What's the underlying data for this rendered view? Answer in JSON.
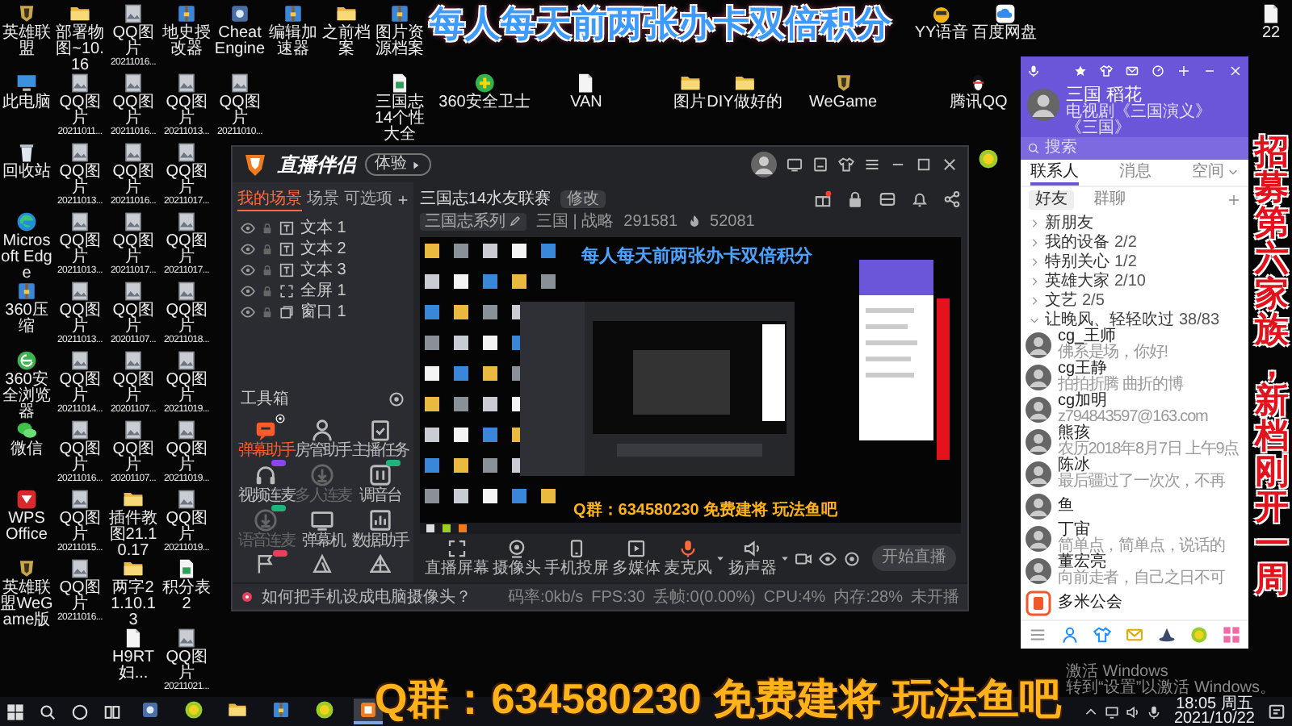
{
  "desktop_columns": [
    {
      "icons": [
        {
          "kind": "game",
          "label": "英雄联盟"
        },
        {
          "kind": "pc",
          "label": "此电脑"
        },
        {
          "kind": "bin",
          "label": "回收站"
        },
        {
          "kind": "edge",
          "label": "Microsoft Edge"
        },
        {
          "kind": "zip",
          "label": "360压缩"
        },
        {
          "kind": "browser",
          "label": "360安全浏览器"
        },
        {
          "kind": "chat",
          "label": "微信"
        },
        {
          "kind": "wps",
          "label": "WPS Office"
        },
        {
          "kind": "game",
          "label": "英雄联盟WeGame版"
        }
      ]
    },
    {
      "icons": [
        {
          "kind": "folder",
          "label": "部署物图~10.16"
        },
        {
          "kind": "photo",
          "label": "QQ图片",
          "sub": "20211011..."
        },
        {
          "kind": "photo",
          "label": "QQ图片",
          "sub": "20211013..."
        },
        {
          "kind": "photo",
          "label": "QQ图片",
          "sub": "20211013..."
        },
        {
          "kind": "photo",
          "label": "QQ图片",
          "sub": "20211013..."
        },
        {
          "kind": "photo",
          "label": "QQ图片",
          "sub": "20211014..."
        },
        {
          "kind": "photo",
          "label": "QQ图片",
          "sub": "20211016..."
        },
        {
          "kind": "photo",
          "label": "QQ图片",
          "sub": "20211015..."
        },
        {
          "kind": "photo",
          "label": "QQ图片",
          "sub": "20211016..."
        }
      ]
    },
    {
      "icons": [
        {
          "kind": "photo",
          "label": "QQ图片",
          "sub": "20211016..."
        },
        {
          "kind": "photo",
          "label": "QQ图片",
          "sub": "20211016..."
        },
        {
          "kind": "photo",
          "label": "QQ图片",
          "sub": "20211016..."
        },
        {
          "kind": "photo",
          "label": "QQ图片",
          "sub": "20211017..."
        },
        {
          "kind": "photo",
          "label": "QQ图片",
          "sub": "20201107..."
        },
        {
          "kind": "photo",
          "label": "QQ图片",
          "sub": "20201107..."
        },
        {
          "kind": "photo",
          "label": "QQ图片",
          "sub": "20201107..."
        },
        {
          "kind": "folder",
          "label": "插件教图21.10.17"
        },
        {
          "kind": "folder",
          "label": "两字21.10.13"
        },
        {
          "kind": "doc",
          "label": "H9RT 妇..."
        }
      ]
    },
    {
      "icons": [
        {
          "kind": "zip",
          "label": "地史授改器"
        },
        {
          "kind": "photo",
          "label": "QQ图片",
          "sub": "20211013..."
        },
        {
          "kind": "photo",
          "label": "QQ图片",
          "sub": "20211017..."
        },
        {
          "kind": "photo",
          "label": "QQ图片",
          "sub": "20211017..."
        },
        {
          "kind": "photo",
          "label": "QQ图片",
          "sub": "20211018..."
        },
        {
          "kind": "photo",
          "label": "QQ图片",
          "sub": "20211019..."
        },
        {
          "kind": "photo",
          "label": "QQ图片",
          "sub": "20211019..."
        },
        {
          "kind": "photo",
          "label": "QQ图片",
          "sub": "20211019..."
        },
        {
          "kind": "sheet",
          "label": "积分表2"
        },
        {
          "kind": "photo",
          "label": "QQ图片",
          "sub": "20211021..."
        }
      ]
    }
  ],
  "desktop_top": [
    {
      "icons": [
        {
          "kind": "app",
          "label": "Cheat Engine"
        },
        {
          "kind": "zip",
          "label": "编辑加速器"
        },
        {
          "kind": "folder",
          "label": "之前档案"
        },
        {
          "kind": "zip",
          "label": "图片资源档案"
        }
      ]
    },
    {
      "icons": [
        {
          "kind": "photo",
          "label": "QQ图片",
          "sub": "20211010..."
        },
        {
          "kind": "sheet",
          "label": "三国志14个性大全"
        }
      ]
    }
  ],
  "desktop_free": [
    {
      "kind": "mascot",
      "label": "YY语音"
    },
    {
      "kind": "cloud",
      "label": "百度网盘"
    },
    {
      "kind": "doc",
      "label": "22"
    },
    {
      "kind": "shield",
      "label": "360安全卫士"
    },
    {
      "kind": "doc",
      "label": "VAN"
    },
    {
      "kind": "folder",
      "label": "图片"
    },
    {
      "kind": "folder",
      "label": "DIY做好的"
    },
    {
      "kind": "game",
      "label": "WeGame"
    },
    {
      "kind": "penguin",
      "label": "腾讯QQ"
    },
    {
      "kind": "ball"
    }
  ],
  "overlays": {
    "top_caption": "每人每天前两张办卡双倍积分",
    "side_caption": "招募第六家族，新档刚开一周",
    "bottom_caption": "Q群：634580230 免费建将 玩法鱼吧"
  },
  "live_app": {
    "title": "直播伴侣",
    "version_tag": "体验",
    "scene_tabs": [
      {
        "label": "我的场景",
        "selected": true
      },
      {
        "label": "场景",
        "selected": false
      },
      {
        "label": "可选项",
        "selected": false
      }
    ],
    "sources": [
      {
        "kind": "text",
        "label": "文本 1"
      },
      {
        "kind": "text",
        "label": "文本 2"
      },
      {
        "kind": "text",
        "label": "文本 3"
      },
      {
        "kind": "screen",
        "label": "全屏 1"
      },
      {
        "kind": "window",
        "label": "窗口 1"
      }
    ],
    "toolbox_title": "工具箱",
    "tools": [
      {
        "label": "弹幕助手",
        "kind": "bubble",
        "selected": true,
        "disabled": false,
        "gear_badge": true
      },
      {
        "label": "房管助手",
        "kind": "person",
        "selected": false,
        "disabled": false
      },
      {
        "label": "主播任务",
        "kind": "clip",
        "selected": false,
        "disabled": false
      },
      {
        "label": "视频连麦",
        "kind": "headset",
        "selected": false,
        "disabled": false,
        "color": "#8e44ec"
      },
      {
        "label": "多人连麦",
        "kind": "download",
        "selected": false,
        "disabled": true
      },
      {
        "label": "调音台",
        "kind": "sliders",
        "selected": false,
        "disabled": false,
        "color": "#1fb57a"
      },
      {
        "label": "语音连麦",
        "kind": "download",
        "selected": false,
        "disabled": true,
        "color": "#1fb57a"
      },
      {
        "label": "弹幕机",
        "kind": "tv",
        "selected": false,
        "disabled": false
      },
      {
        "label": "数据助手",
        "kind": "chart",
        "selected": false,
        "disabled": false
      },
      {
        "kind": "flag",
        "selected": false,
        "disabled": false,
        "color": "#e8405a"
      },
      {
        "kind": "triangle",
        "selected": false,
        "disabled": false
      },
      {
        "kind": "tent",
        "selected": false,
        "disabled": false
      }
    ],
    "stream": {
      "title": "三国志14水友联赛",
      "edit_label": "修改",
      "category": "三国志系列",
      "tags": "三国 | 战略",
      "room": "291581",
      "heat": "52081"
    },
    "preview": {
      "top_caption": "每人每天前两张办卡双倍积分",
      "bottom_caption": "Q群：634580230 免费建将 玩法鱼吧"
    },
    "controls": [
      {
        "label": "直播屏幕",
        "kind": "screen",
        "on": false,
        "dropdown": false
      },
      {
        "label": "摄像头",
        "kind": "webcam",
        "on": false,
        "dropdown": false
      },
      {
        "label": "手机投屏",
        "kind": "phone",
        "on": false,
        "dropdown": false
      },
      {
        "label": "多媒体",
        "kind": "play",
        "on": false,
        "dropdown": false
      },
      {
        "label": "麦克风",
        "kind": "mic",
        "on": true,
        "dropdown": true
      },
      {
        "label": "扬声器",
        "kind": "speaker",
        "on": false,
        "dropdown": true
      }
    ],
    "start_label": "开始直播",
    "status": {
      "tip": "如何把手机设成电脑摄像头？",
      "metrics": [
        "码率:0kb/s",
        "FPS:30",
        "丢帧:0(0.00%)",
        "CPU:4%",
        "内存:28%",
        "未开播"
      ]
    }
  },
  "qq": {
    "name": "三国 稻花",
    "signature": "电视剧《三国演义》《三国》",
    "search_placeholder": "搜索",
    "tabs": [
      {
        "label": "联系人",
        "selected": true,
        "dropdown": false
      },
      {
        "label": "消息",
        "selected": false,
        "dropdown": false
      },
      {
        "label": "空间",
        "selected": false,
        "dropdown": true
      }
    ],
    "subtabs": [
      {
        "label": "好友",
        "selected": true
      },
      {
        "label": "群聊",
        "selected": false
      }
    ],
    "groups": [
      {
        "name": "新朋友",
        "expanded": false
      },
      {
        "name": "我的设备",
        "count": "2/2",
        "expanded": false
      },
      {
        "name": "特别关心",
        "count": "1/2",
        "expanded": false
      },
      {
        "name": "英雄大家",
        "count": "2/10",
        "expanded": false
      },
      {
        "name": "文艺",
        "count": "2/5",
        "expanded": false
      },
      {
        "name": "让晚风、轻轻吹过",
        "count": "38/83",
        "expanded": true
      }
    ],
    "contacts": [
      {
        "kind": "person",
        "name": "cg_王师",
        "status": "佛系是场，你好!"
      },
      {
        "kind": "person",
        "name": "cg王静",
        "status": "拍拍折腾 曲折的博"
      },
      {
        "kind": "person",
        "name": "cg加明",
        "status": "z794843597@163.com"
      },
      {
        "kind": "person",
        "name": "熊孩",
        "status": "农历2018年8月7日 上午9点"
      },
      {
        "kind": "person",
        "name": "陈冰",
        "status": "最后疆过了一次次，不再"
      },
      {
        "kind": "person",
        "name": "鱼"
      },
      {
        "kind": "person",
        "name": "丁宙",
        "status": "简单点，简单点，说话的"
      },
      {
        "kind": "person",
        "name": "董宏亮",
        "status": "向前走者，自己之日不可"
      },
      {
        "kind": "official",
        "name": "多米公会"
      }
    ]
  },
  "activation": {
    "title": "激活 Windows",
    "text": "转到“设置”以激活 Windows。"
  },
  "taskbar": {
    "apps": [
      {
        "kind": "app",
        "selected": false
      },
      {
        "kind": "ball",
        "selected": false
      },
      {
        "kind": "folder",
        "selected": false
      },
      {
        "kind": "zip",
        "selected": false
      },
      {
        "kind": "ball",
        "selected": false
      },
      {
        "kind": "orange",
        "selected": true
      }
    ],
    "time": "18:05 周五",
    "date": "2021/10/22"
  }
}
